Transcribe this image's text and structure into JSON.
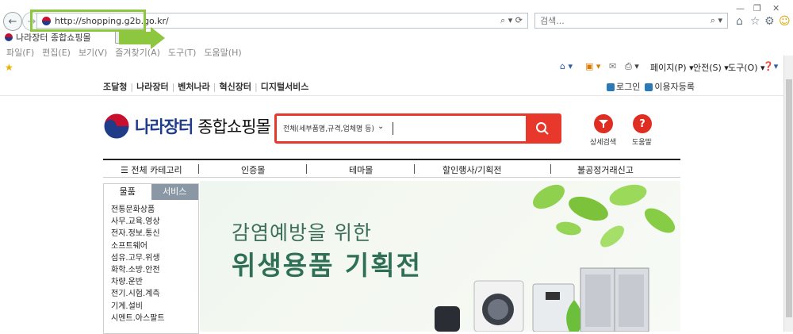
{
  "browser": {
    "url": "http://shopping.g2b.go.kr/",
    "search_placeholder": "검색...",
    "tab_title": "나라장터 종합쇼핑몰",
    "menu": [
      "파일(F)",
      "편집(E)",
      "보기(V)",
      "즐겨찾기(A)",
      "도구(T)",
      "도움말(H)"
    ],
    "commands": {
      "page": "페이지(P) ▾",
      "safety": "안전(S) ▾",
      "tools": "도구(O) ▾"
    }
  },
  "site": {
    "top_links": [
      "조달청",
      "나라장터",
      "벤처나라",
      "혁신장터",
      "디지털서비스"
    ],
    "login": "로그인",
    "register": "이용자등록",
    "logo_primary": "나라장터",
    "logo_secondary": "종합쇼핑몰",
    "search_category": "전체(세부품명,규격,업체명 등)",
    "detail_search": "상세검색",
    "help": "도움말",
    "gnb": [
      "전체 카테고리",
      "인증몰",
      "테마몰",
      "할인행사/기획전",
      "불공정거래신고"
    ],
    "cat_tabs": [
      "물품",
      "서비스"
    ],
    "categories": [
      "전통문화상품",
      "사무.교육.영상",
      "전자.정보.통신",
      "소프트웨어",
      "섬유.고무.위생",
      "화학.소방.안전",
      "차량.운반",
      "전기.시험.계측",
      "기계.설비",
      "시멘트.아스팔트"
    ],
    "banner_line1": "감염예방을 위한",
    "banner_line2": "위생용품 기획전"
  },
  "colors": {
    "accent": "#e8382c",
    "callout": "#8dc63f",
    "brand_blue": "#1f3c88"
  }
}
